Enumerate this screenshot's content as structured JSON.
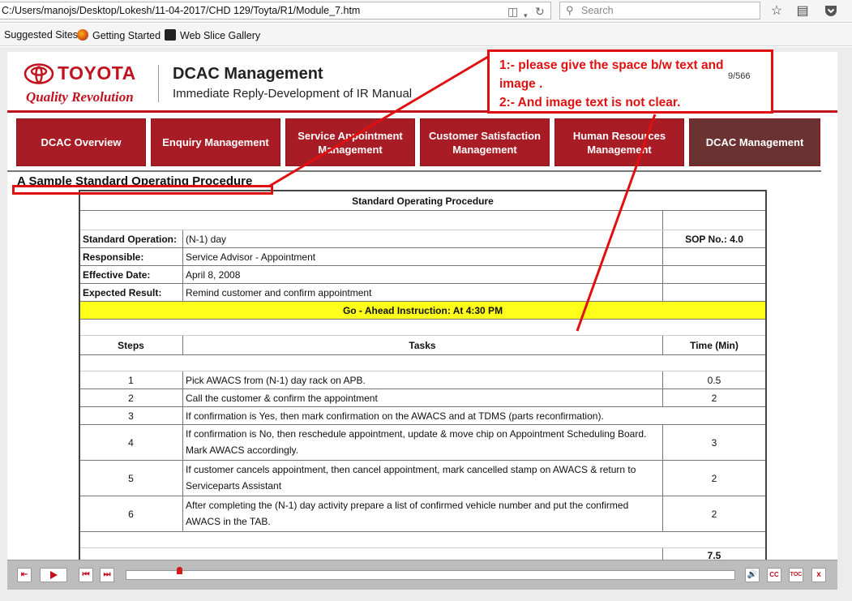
{
  "browser": {
    "url": "C:/Users/manojs/Desktop/Lokesh/11-04-2017/CHD 129/Toyta/R1/Module_7.htm",
    "search_placeholder": "Search",
    "bookmarks": [
      "Suggested Sites",
      "Getting Started",
      "Web Slice Gallery"
    ]
  },
  "course": {
    "brand": "TOYOTA",
    "tagline": "Quality Revolution",
    "title": "DCAC Management",
    "subtitle": "Immediate Reply-Development of IR Manual",
    "page_counter": "9/566",
    "nav": [
      {
        "label": "DCAC Overview"
      },
      {
        "label": "Enquiry Management"
      },
      {
        "label": "Service Appointment Management"
      },
      {
        "label": "Customer Satisfaction Management"
      },
      {
        "label": "Human Resources Management"
      },
      {
        "label": "DCAC Management"
      }
    ],
    "section_title": "A Sample Standard Operating Procedure"
  },
  "sop": {
    "title": "Standard Operating Procedure",
    "standard_operation_label": "Standard Operation:",
    "standard_operation_value": "(N-1) day",
    "sop_no": "SOP No.: 4.0",
    "responsible_label": "Responsible:",
    "responsible_value": "Service Advisor - Appointment",
    "effective_date_label": "Effective Date:",
    "effective_date_value": "April 8, 2008",
    "expected_result_label": "Expected Result:",
    "expected_result_value": "Remind customer and confirm appointment",
    "instruction": "Go - Ahead Instruction: At 4:30 PM",
    "col_steps": "Steps",
    "col_tasks": "Tasks",
    "col_time": "Time (Min)",
    "rows": [
      {
        "step": "1",
        "task": "Pick AWACS from (N-1) day rack on APB.",
        "time": "0.5"
      },
      {
        "step": "2",
        "task": "Call the customer & confirm the appointment",
        "time": "2"
      },
      {
        "step": "3",
        "task": "If confirmation is Yes, then mark confirmation on the AWACS and at TDMS (parts reconfirmation).",
        "time": ""
      },
      {
        "step": "4",
        "task": "If confirmation is No, then reschedule appointment, update & move chip on Appointment Scheduling Board. Mark AWACS accordingly.",
        "time": "3"
      },
      {
        "step": "5",
        "task": "If customer cancels appointment, then cancel appointment, mark cancelled stamp on AWACS & return to Serviceparts Assistant",
        "time": "2"
      },
      {
        "step": "6",
        "task": "After completing the (N-1) day activity prepare a list of confirmed vehicle number and put the confirmed AWACS in the TAB.",
        "time": "2"
      }
    ],
    "total": "7.5"
  },
  "annotation": {
    "line1": "1:- please give the space b/w text and",
    "line2": "image .",
    "line3": "2:- And image text is not clear.",
    "color": "#e01010"
  },
  "player": {
    "cc_label": "CC",
    "toc_label": "TOC",
    "close_label": "x",
    "progress": 0.08
  }
}
